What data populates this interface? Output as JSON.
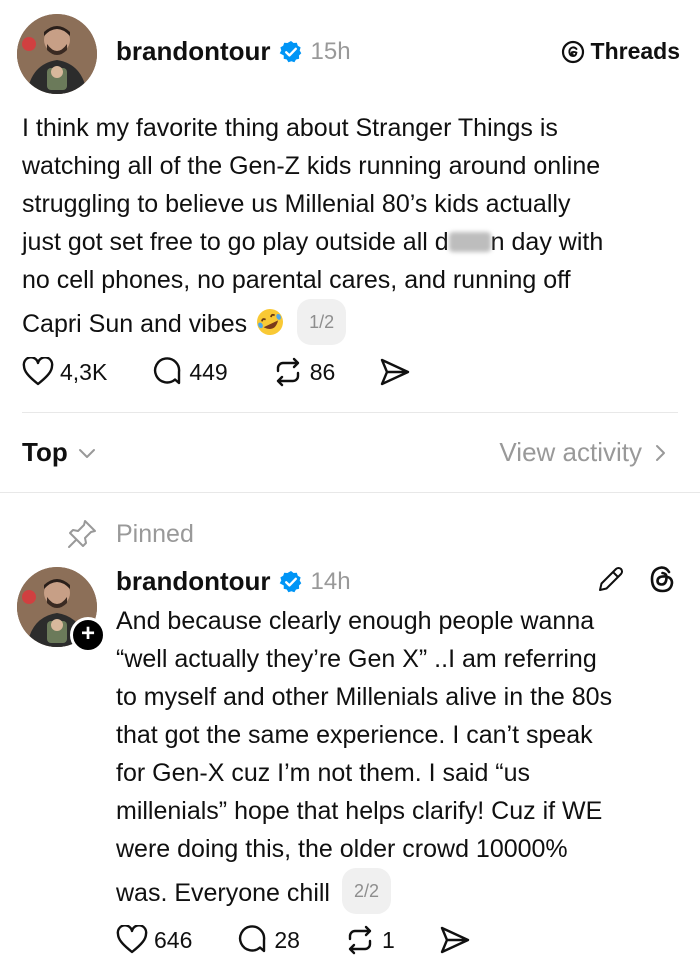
{
  "post1": {
    "username": "brandontour",
    "timestamp": "15h",
    "app_badge": "Threads",
    "text_before_blur": "I think my favorite thing about Stranger Things is\nwatching all of the Gen-Z kids running around online\nstruggling to believe us Millenial 80’s kids actually\njust got set free to go play outside all d",
    "text_after_blur": "n day with\nno cell phones, no parental cares, and running off\nCapri Sun and vibes",
    "emoji": "rolling-on-floor-laughing-emoji",
    "page_indicator": "1/2",
    "likes": "4,3K",
    "replies": "449",
    "reposts": "86"
  },
  "sort": {
    "label": "Top",
    "view_activity": "View activity"
  },
  "post2": {
    "pinned_label": "Pinned",
    "username": "brandontour",
    "timestamp": "14h",
    "text": "And because clearly enough people wanna\n“well actually they’re Gen X” ..I am referring\nto myself and other Millenials alive in the 80s\nthat got the same experience. I can’t speak\nfor Gen-X cuz I’m not them. I said “us\nmillenials”  hope that helps clarify! Cuz if WE\nwere doing this, the older crowd 10000%\nwas. Everyone chill",
    "page_indicator": "2/2",
    "likes": "646",
    "replies": "28",
    "reposts": "1"
  },
  "colors": {
    "verified": "#0095f6",
    "muted": "#999999",
    "text": "#101010"
  }
}
